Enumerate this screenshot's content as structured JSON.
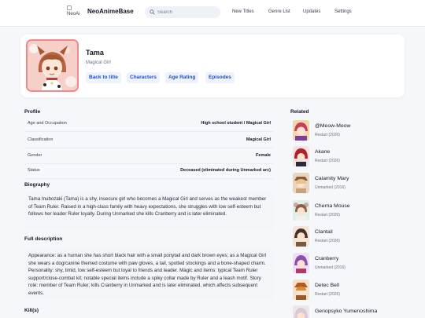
{
  "header": {
    "logo_alt": "NeoAi",
    "site_name": "NeoAnimeBase",
    "search_placeholder": "Search",
    "nav": [
      "New Titles",
      "Genre List",
      "Updates",
      "Settings"
    ]
  },
  "profile": {
    "name": "Tama",
    "subtitle": "Magical Girl",
    "buttons": [
      "Back to title",
      "Characters",
      "Age Rating",
      "Episodes"
    ]
  },
  "sections": {
    "profile_title": "Profile",
    "biography_title": "Biography",
    "full_description_title": "Full description",
    "kills_title": "Kill(s)",
    "related_title": "Related"
  },
  "profile_rows": [
    {
      "key": "Age and Occupation",
      "value": "High school student / Magical Girl"
    },
    {
      "key": "Classification",
      "value": "Magical Girl"
    },
    {
      "key": "Gender",
      "value": "Female"
    },
    {
      "key": "Status",
      "value": "Deceased (eliminated during Unmarked arc)"
    }
  ],
  "biography": "Tama Inubozaki (Tama) is a shy, insecure girl who becomes a Magical Girl and serves as the weakest member of Team Ruler. Raised in a high-class family with heavy expectations, she struggles with low self-esteem but follows her leader Ruler loyally. During Unmarked she kills Cranberry and is later eliminated.",
  "full_description": "Appearance: as a human she has short black hair with a small ponytail and dark brown eyes; as a Magical Girl she wears a dog/canine themed costume with paw gloves, a tail, spotted stockings and a bone-shaped charm. Personality: shy, timid, low self-esteem but loyal to friends and leader. Magic and items: typical Team Ruler support/close-combat kit; notable special items include a spiky collar made by Ruler and a leash motif. Story role: member of Team Ruler; kills Cranberry in Unmarked and is later eliminated, which affects subsequent events.",
  "related": [
    {
      "name": "@Meow-Meow",
      "meta": "Restart (2026)"
    },
    {
      "name": "Akane",
      "meta": "Restart (2026)"
    },
    {
      "name": "Calamity Mary",
      "meta": "Unmarked (2016)"
    },
    {
      "name": "Cherna Mouse",
      "meta": "Restart (2026)"
    },
    {
      "name": "Clantail",
      "meta": "Restart (2026)"
    },
    {
      "name": "Cranberry",
      "meta": "Unmarked (2016)"
    },
    {
      "name": "Detec Bell",
      "meta": "Restart (2026)"
    },
    {
      "name": "Genopsyko Yumenoshima",
      "meta": ""
    }
  ],
  "colors": {
    "accent": "#1d4ed8",
    "pill_bg": "#eef2fb",
    "page_bg": "#f5f7fb",
    "text_box_bg": "#f3f5f9"
  }
}
